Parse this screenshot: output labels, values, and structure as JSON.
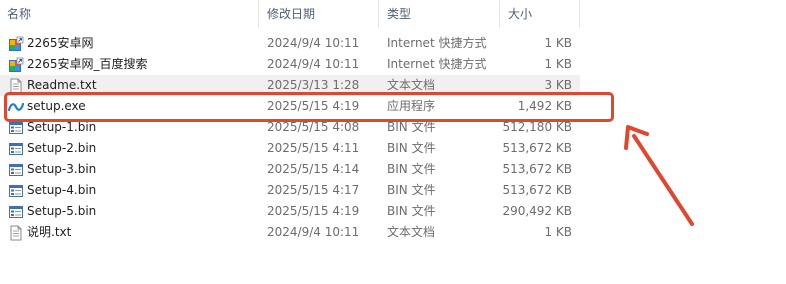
{
  "columns": {
    "name": "名称",
    "date": "修改日期",
    "type": "类型",
    "size": "大小"
  },
  "files": [
    {
      "name": "2265安卓网",
      "date": "2024/9/4 10:11",
      "type": "Internet 快捷方式",
      "size": "1 KB",
      "icon": "internet-shortcut-icon"
    },
    {
      "name": "2265安卓网_百度搜索",
      "date": "2024/9/4 10:11",
      "type": "Internet 快捷方式",
      "size": "1 KB",
      "icon": "internet-shortcut-icon"
    },
    {
      "name": "Readme.txt",
      "date": "2025/3/13 1:28",
      "type": "文本文档",
      "size": "3 KB",
      "icon": "text-file-icon"
    },
    {
      "name": "setup.exe",
      "date": "2025/5/15 4:19",
      "type": "应用程序",
      "size": "1,492 KB",
      "icon": "setup-exe-icon"
    },
    {
      "name": "Setup-1.bin",
      "date": "2025/5/15 4:08",
      "type": "BIN 文件",
      "size": "512,180 KB",
      "icon": "bin-file-icon"
    },
    {
      "name": "Setup-2.bin",
      "date": "2025/5/15 4:11",
      "type": "BIN 文件",
      "size": "513,672 KB",
      "icon": "bin-file-icon"
    },
    {
      "name": "Setup-3.bin",
      "date": "2025/5/15 4:14",
      "type": "BIN 文件",
      "size": "513,672 KB",
      "icon": "bin-file-icon"
    },
    {
      "name": "Setup-4.bin",
      "date": "2025/5/15 4:17",
      "type": "BIN 文件",
      "size": "513,672 KB",
      "icon": "bin-file-icon"
    },
    {
      "name": "Setup-5.bin",
      "date": "2025/5/15 4:19",
      "type": "BIN 文件",
      "size": "290,492 KB",
      "icon": "bin-file-icon"
    },
    {
      "name": "说明.txt",
      "date": "2024/9/4 10:11",
      "type": "文本文档",
      "size": "1 KB",
      "icon": "text-file-icon"
    }
  ],
  "highlight_color": "#e1472f",
  "alt_row_color": "#f0f0f0"
}
